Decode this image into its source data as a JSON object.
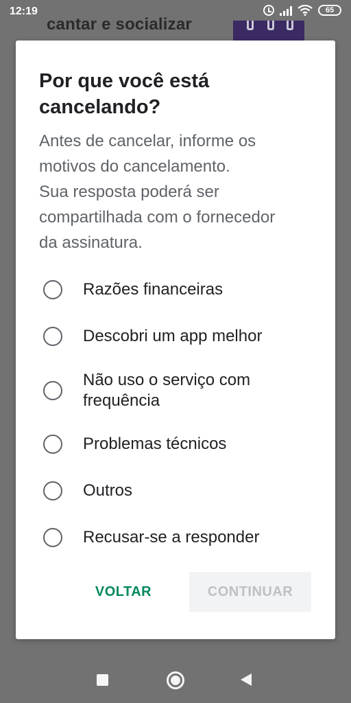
{
  "status_bar": {
    "time": "12:19",
    "battery": "65"
  },
  "background": {
    "partial_title": "cantar e socializar"
  },
  "dialog": {
    "title": "Por que você está cancelando?",
    "description_lines": [
      "Antes de cancelar, informe os",
      "motivos do cancelamento.",
      "Sua resposta poderá ser",
      "compartilhada com o fornecedor",
      "da assinatura."
    ],
    "options": [
      {
        "label": "Razões financeiras",
        "selected": false
      },
      {
        "label": "Descobri um app melhor",
        "selected": false
      },
      {
        "label": "Não uso o serviço com frequência",
        "selected": false
      },
      {
        "label": "Problemas técnicos",
        "selected": false
      },
      {
        "label": "Outros",
        "selected": false
      },
      {
        "label": "Recusar-se a responder",
        "selected": false
      }
    ],
    "back_label": "VOLTAR",
    "continue_label": "CONTINUAR",
    "continue_enabled": false
  },
  "colors": {
    "accent": "#01875f",
    "disabled_text": "#bdc1c6",
    "disabled_bg": "#f1f3f4"
  },
  "icons": {
    "nav_recent": "square-icon",
    "nav_home": "circle-icon",
    "nav_back": "triangle-back-icon"
  }
}
